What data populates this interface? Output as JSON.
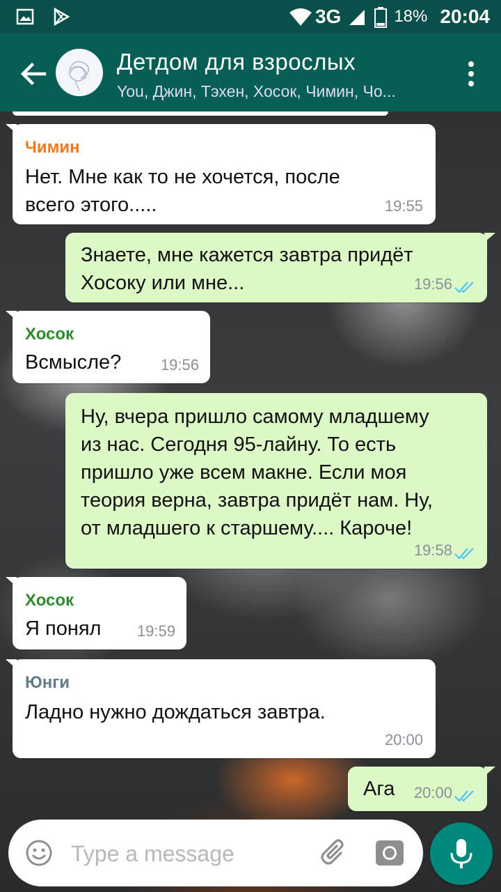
{
  "status_bar": {
    "network": "3G",
    "battery": "18%",
    "time": "20:04"
  },
  "header": {
    "title": "Детдом для взрослых",
    "subtitle": "You, Джин, Тэхен, Хосок, Чимин, Чо..."
  },
  "messages": [
    {
      "direction": "in",
      "sender": "Чимин",
      "sender_color": "#f07a20",
      "text_lines": [
        "Нет. Мне как то не хочется, после",
        "всего этого....."
      ],
      "time": "19:55"
    },
    {
      "direction": "out",
      "text_lines": [
        "Знаете, мне кажется завтра придёт",
        "Хосоку или мне..."
      ],
      "time": "19:56",
      "read": true
    },
    {
      "direction": "in",
      "sender": "Хосок",
      "sender_color": "#2e8b2e",
      "text_lines": [
        "Всмысле?"
      ],
      "time": "19:56"
    },
    {
      "direction": "out",
      "text_lines": [
        "Ну, вчера пришло самому младшему",
        "из нас. Сегодня 95-лайну. То есть",
        "пришло уже всем макне. Если моя",
        "теория верна, завтра придёт нам. Ну,",
        "от младшего к старшему.... Кароче!"
      ],
      "time": "19:58",
      "read": true
    },
    {
      "direction": "in",
      "sender": "Хосок",
      "sender_color": "#2e8b2e",
      "text_lines": [
        "Я понял"
      ],
      "time": "19:59"
    },
    {
      "direction": "in",
      "sender": "Юнги",
      "sender_color": "#607d8b",
      "text_lines": [
        "Ладно нужно дождаться завтра."
      ],
      "time": "20:00"
    },
    {
      "direction": "out",
      "text_lines": [
        "Ага"
      ],
      "time": "20:00",
      "read": true
    }
  ],
  "composer": {
    "placeholder": "Type a message"
  },
  "colors": {
    "status_bar": "#0b4f4a",
    "app_bar": "#075e54",
    "outgoing_bubble": "#dcf8c6",
    "incoming_bubble": "#ffffff",
    "read_ticks": "#4fc3f7",
    "mic_button": "#00897b"
  },
  "icons": [
    "gallery-icon",
    "play-store-icon",
    "wifi-icon",
    "signal-icon",
    "battery-icon",
    "back-arrow-icon",
    "group-avatar-icon",
    "more-vert-icon",
    "emoji-icon",
    "attach-icon",
    "camera-icon",
    "mic-icon",
    "double-check-icon"
  ]
}
